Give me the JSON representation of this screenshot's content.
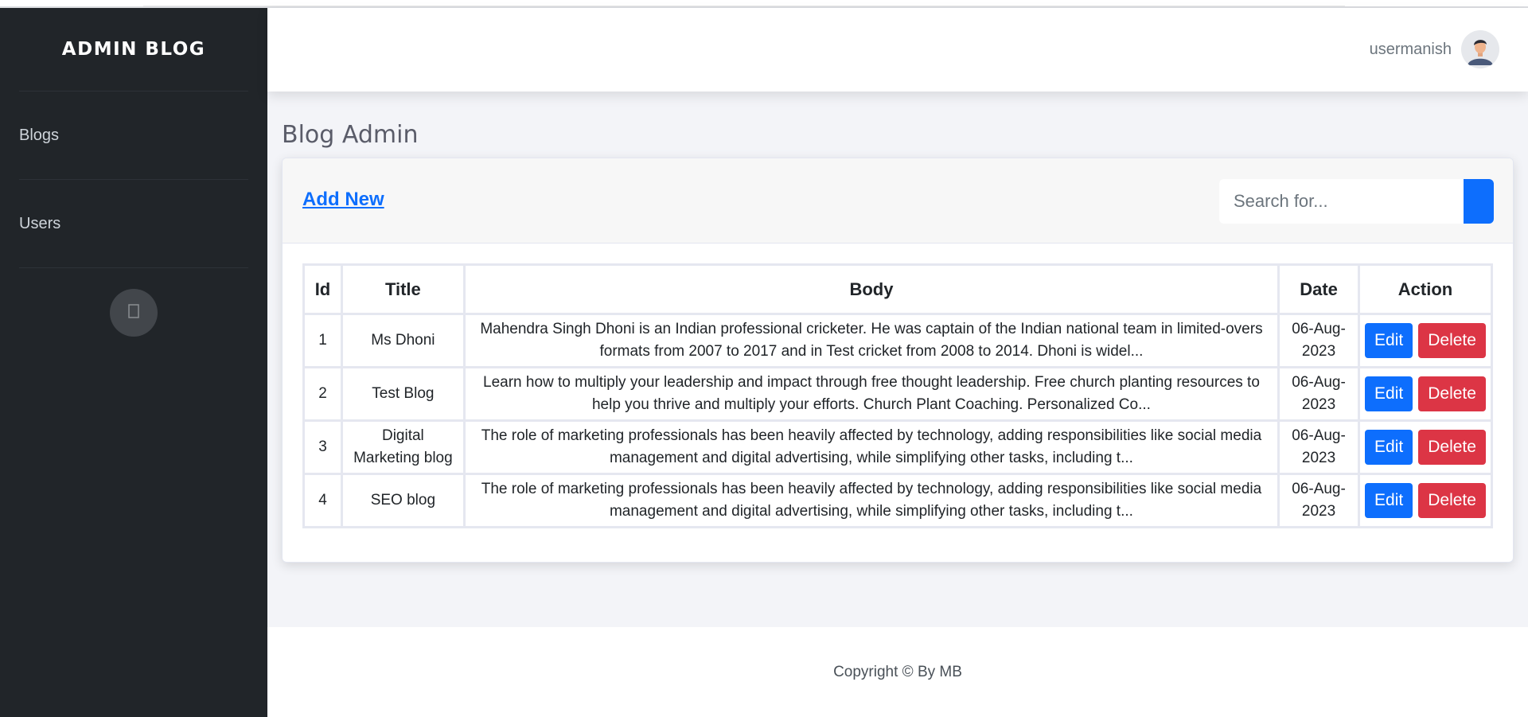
{
  "sidebar": {
    "brand": "ADMIN BLOG",
    "items": [
      {
        "label": "Blogs"
      },
      {
        "label": "Users"
      }
    ],
    "toggle_icon": "chevron-left-icon"
  },
  "topbar": {
    "username": "usermanish",
    "avatar_icon": "user-avatar-icon"
  },
  "page": {
    "title": "Blog Admin"
  },
  "card": {
    "add_new_label": "Add New",
    "search_placeholder": "Search for...",
    "search_icon": "search-icon"
  },
  "table": {
    "headers": [
      "Id",
      "Title",
      "Body",
      "Date",
      "Action"
    ],
    "rows": [
      {
        "id": "1",
        "title": "Ms Dhoni",
        "body": "Mahendra Singh Dhoni is an Indian professional cricketer. He was captain of the Indian national team in limited-overs formats from 2007 to 2017 and in Test cricket from 2008 to 2014. Dhoni is widel...",
        "date": "06-Aug-2023",
        "edit": "Edit",
        "delete": "Delete"
      },
      {
        "id": "2",
        "title": "Test Blog",
        "body": "Learn how to multiply your leadership and impact through free thought leadership. Free church planting resources to help you thrive and multiply your efforts. Church Plant Coaching. Personalized Co...",
        "date": "06-Aug-2023",
        "edit": "Edit",
        "delete": "Delete"
      },
      {
        "id": "3",
        "title": "Digital Marketing blog",
        "body": "The role of marketing professionals has been heavily affected by technology, adding responsibilities like social media management and digital advertising, while simplifying other tasks, including t...",
        "date": "06-Aug-2023",
        "edit": "Edit",
        "delete": "Delete"
      },
      {
        "id": "4",
        "title": "SEO blog",
        "body": "The role of marketing professionals has been heavily affected by technology, adding responsibilities like social media management and digital advertising, while simplifying other tasks, including t...",
        "date": "06-Aug-2023",
        "edit": "Edit",
        "delete": "Delete"
      }
    ]
  },
  "footer": {
    "text": "Copyright © By MB"
  },
  "colors": {
    "sidebar_bg": "#212529",
    "primary": "#0d6efd",
    "danger": "#dc3545",
    "page_bg": "#f3f4f8"
  }
}
